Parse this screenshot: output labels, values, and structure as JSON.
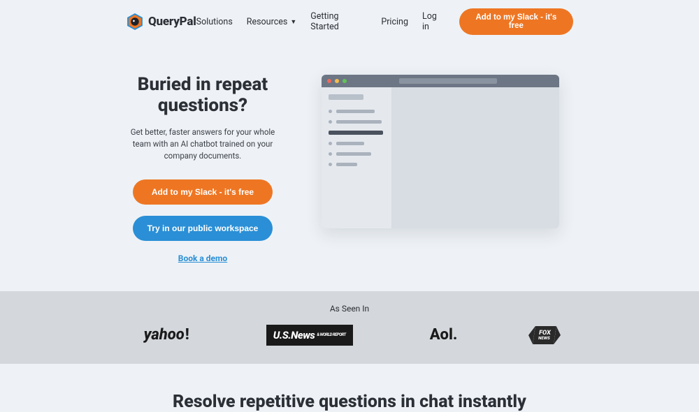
{
  "nav": {
    "brand": "QueryPal",
    "items": [
      "Solutions",
      "Resources",
      "Getting Started",
      "Pricing",
      "Log in"
    ],
    "cta": "Add to my Slack - it's free"
  },
  "hero": {
    "title": "Buried in repeat questions?",
    "subtitle": "Get better, faster answers for your whole team with an AI chatbot trained on your company documents.",
    "cta_primary": "Add to my Slack - it's free",
    "cta_secondary": "Try in our public workspace",
    "cta_demo": "Book a demo"
  },
  "seen": {
    "title": "As Seen In",
    "logos": {
      "yahoo": "yahoo",
      "usnews": "U.S.News",
      "usnews_sub": "& WORLD REPORT",
      "aol": "Aol.",
      "fox_top": "FOX",
      "fox_bot": "NEWS"
    }
  },
  "section2": {
    "title": "Resolve repetitive questions in chat instantly"
  }
}
